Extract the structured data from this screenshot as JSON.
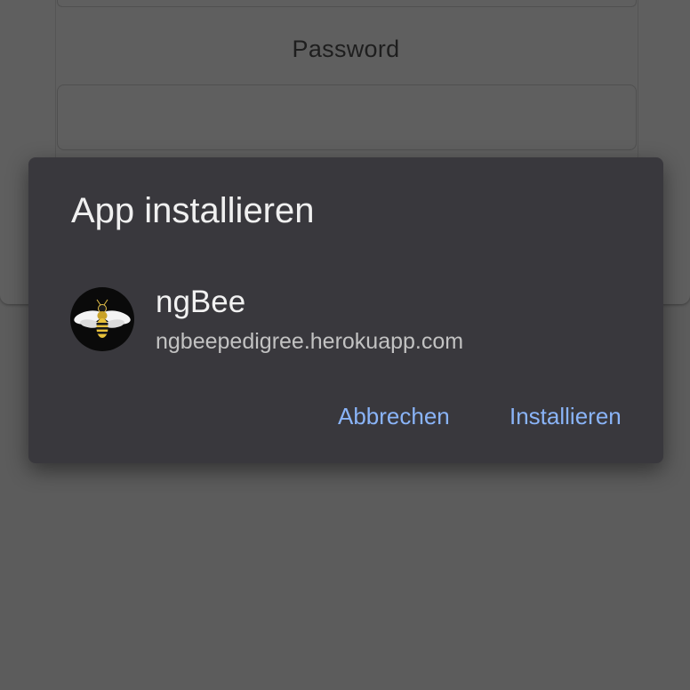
{
  "background": {
    "password_label": "Password"
  },
  "dialog": {
    "title": "App installieren",
    "app": {
      "name": "ngBee",
      "url": "ngbeepedigree.herokuapp.com",
      "icon": "bee-icon"
    },
    "cancel_label": "Abbrechen",
    "install_label": "Installieren"
  },
  "colors": {
    "scrim": "#5c5c5c",
    "dialog_bg": "#39383d",
    "accent": "#8ab4f8"
  }
}
